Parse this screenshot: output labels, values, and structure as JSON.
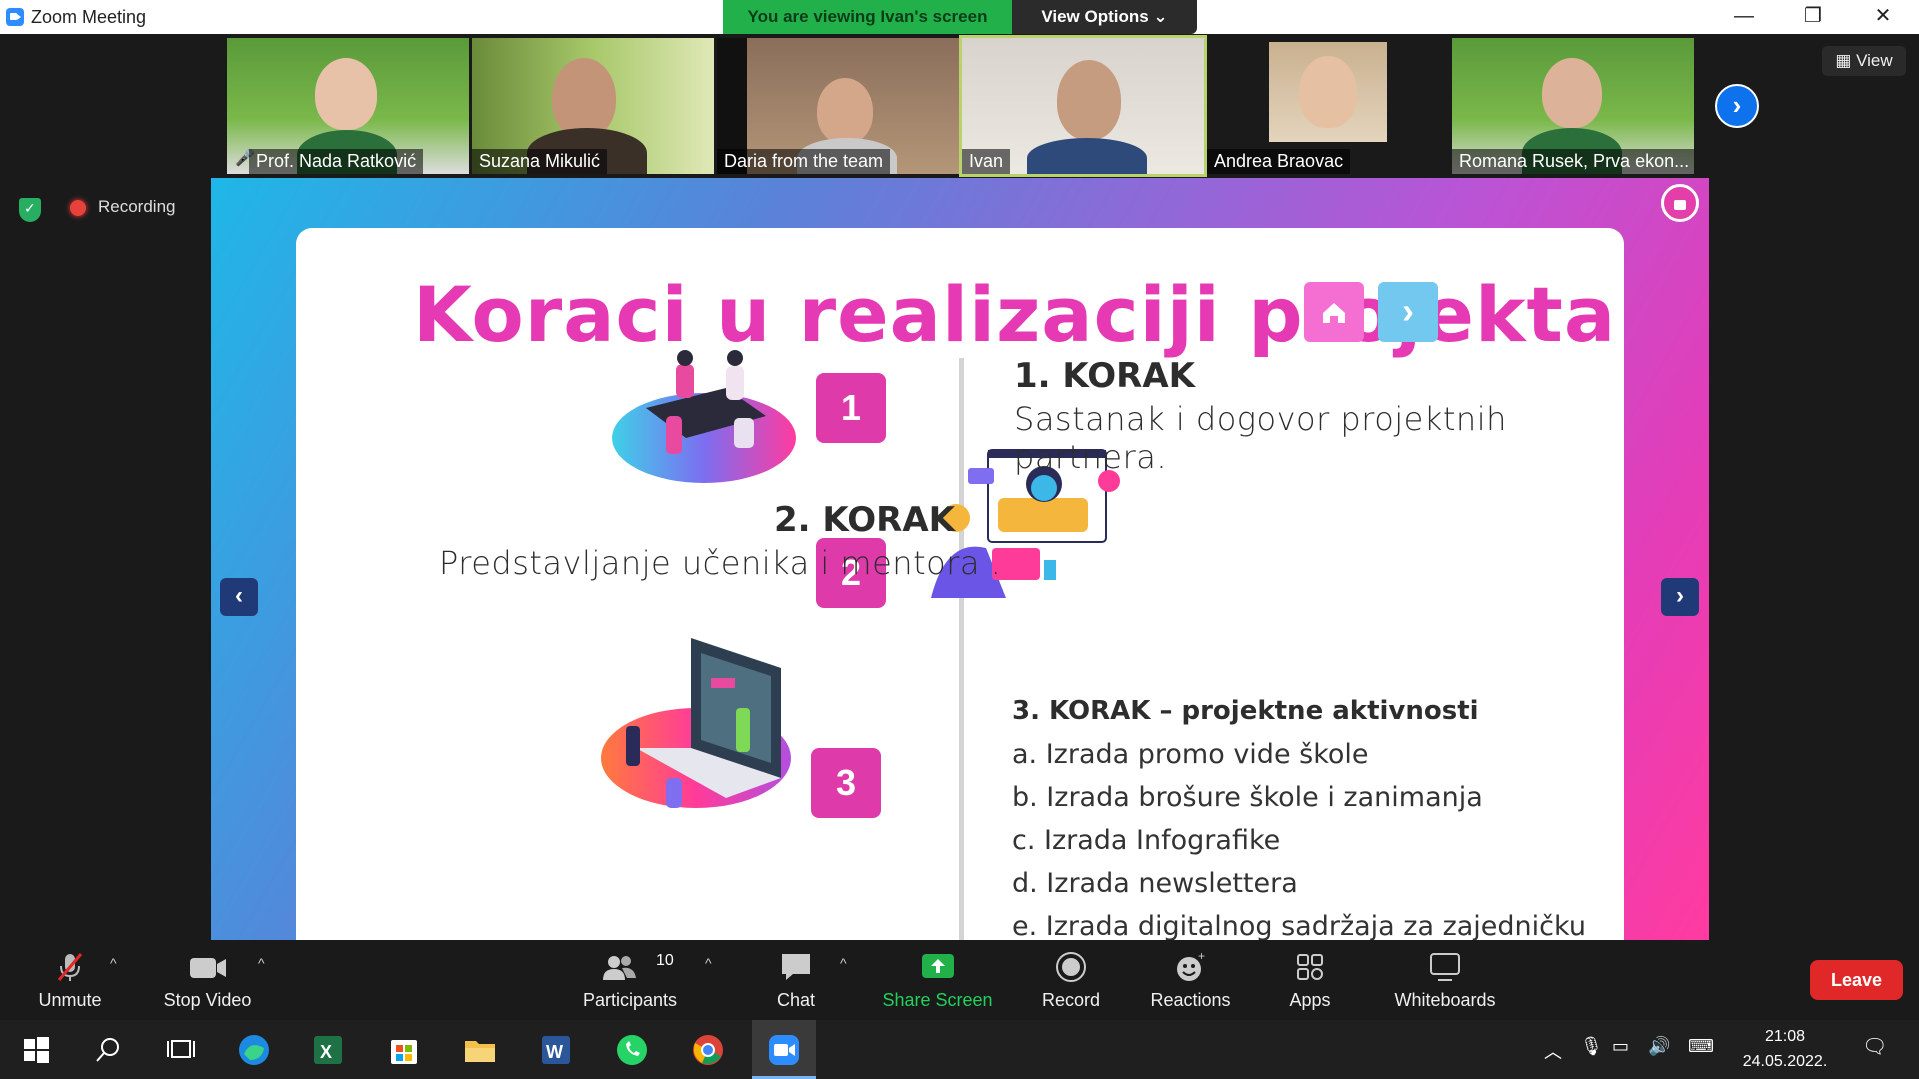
{
  "window": {
    "title": "Zoom Meeting"
  },
  "banner": {
    "viewing": "You are viewing Ivan's screen",
    "view_options": "View Options ⌄"
  },
  "controls": {
    "minimize": "—",
    "restore": "❐",
    "close": "✕"
  },
  "participants_strip": [
    {
      "name": "Prof. Nada Ratković",
      "muted": true
    },
    {
      "name": "Suzana Mikulić"
    },
    {
      "name": "Daria from the team"
    },
    {
      "name": "Ivan",
      "active": true
    },
    {
      "name": "Andrea Braovac"
    },
    {
      "name": "Romana Rusek, Prva ekon..."
    }
  ],
  "view_button": "View",
  "recording": {
    "label": "Recording"
  },
  "slide": {
    "title": "Koraci u realizaciji projekta",
    "steps": [
      {
        "num": "1",
        "head": "1. KORAK",
        "text": "Sastanak i dogovor projektnih partnera."
      },
      {
        "num": "2",
        "head": "2. KORAK",
        "text": "Predstavljanje učenika i mentora ."
      },
      {
        "num": "3",
        "head": "3. KORAK – projektne aktivnosti",
        "items": [
          "a. Izrada promo vide škole",
          "b. Izrada brošure škole i zanimanja",
          "c. Izrada Infografike",
          "d. Izrada newslettera",
          "e. Izrada digitalnog sadržaja za zajedničku galeriju"
        ]
      }
    ]
  },
  "toolbar": {
    "unmute": "Unmute",
    "stop_video": "Stop Video",
    "participants": "Participants",
    "participant_count": "10",
    "chat": "Chat",
    "share_screen": "Share Screen",
    "record": "Record",
    "reactions": "Reactions",
    "apps": "Apps",
    "whiteboards": "Whiteboards",
    "leave": "Leave"
  },
  "clock": {
    "time": "21:08",
    "date": "24.05.2022."
  },
  "colors": {
    "accent": "#e63ab5",
    "share_green": "#22b04b",
    "leave_red": "#e02828",
    "zoom_blue": "#0e72ed"
  }
}
